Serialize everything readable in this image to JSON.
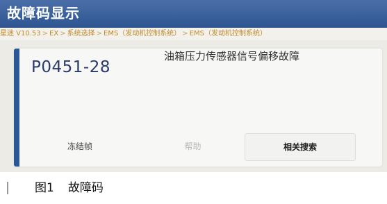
{
  "header": {
    "title": "故障码显示"
  },
  "breadcrumb": {
    "items": [
      "星迷 V10.53",
      "EX",
      "系统选择",
      "EMS（发动机控制系统）",
      "EMS（发动机控制系统）"
    ],
    "separator": ">"
  },
  "dtc": {
    "code": "P0451-28",
    "description": "油箱压力传感器信号偏移故障"
  },
  "buttons": {
    "freeze_frame": "冻结帧",
    "help": "帮助",
    "related_search": "相关搜索"
  },
  "caption": {
    "figure": "图1",
    "text": "故障码"
  },
  "colors": {
    "title_bar": "#2f5591",
    "accent": "#2b5797",
    "breadcrumb_text": "#c08a2a"
  }
}
